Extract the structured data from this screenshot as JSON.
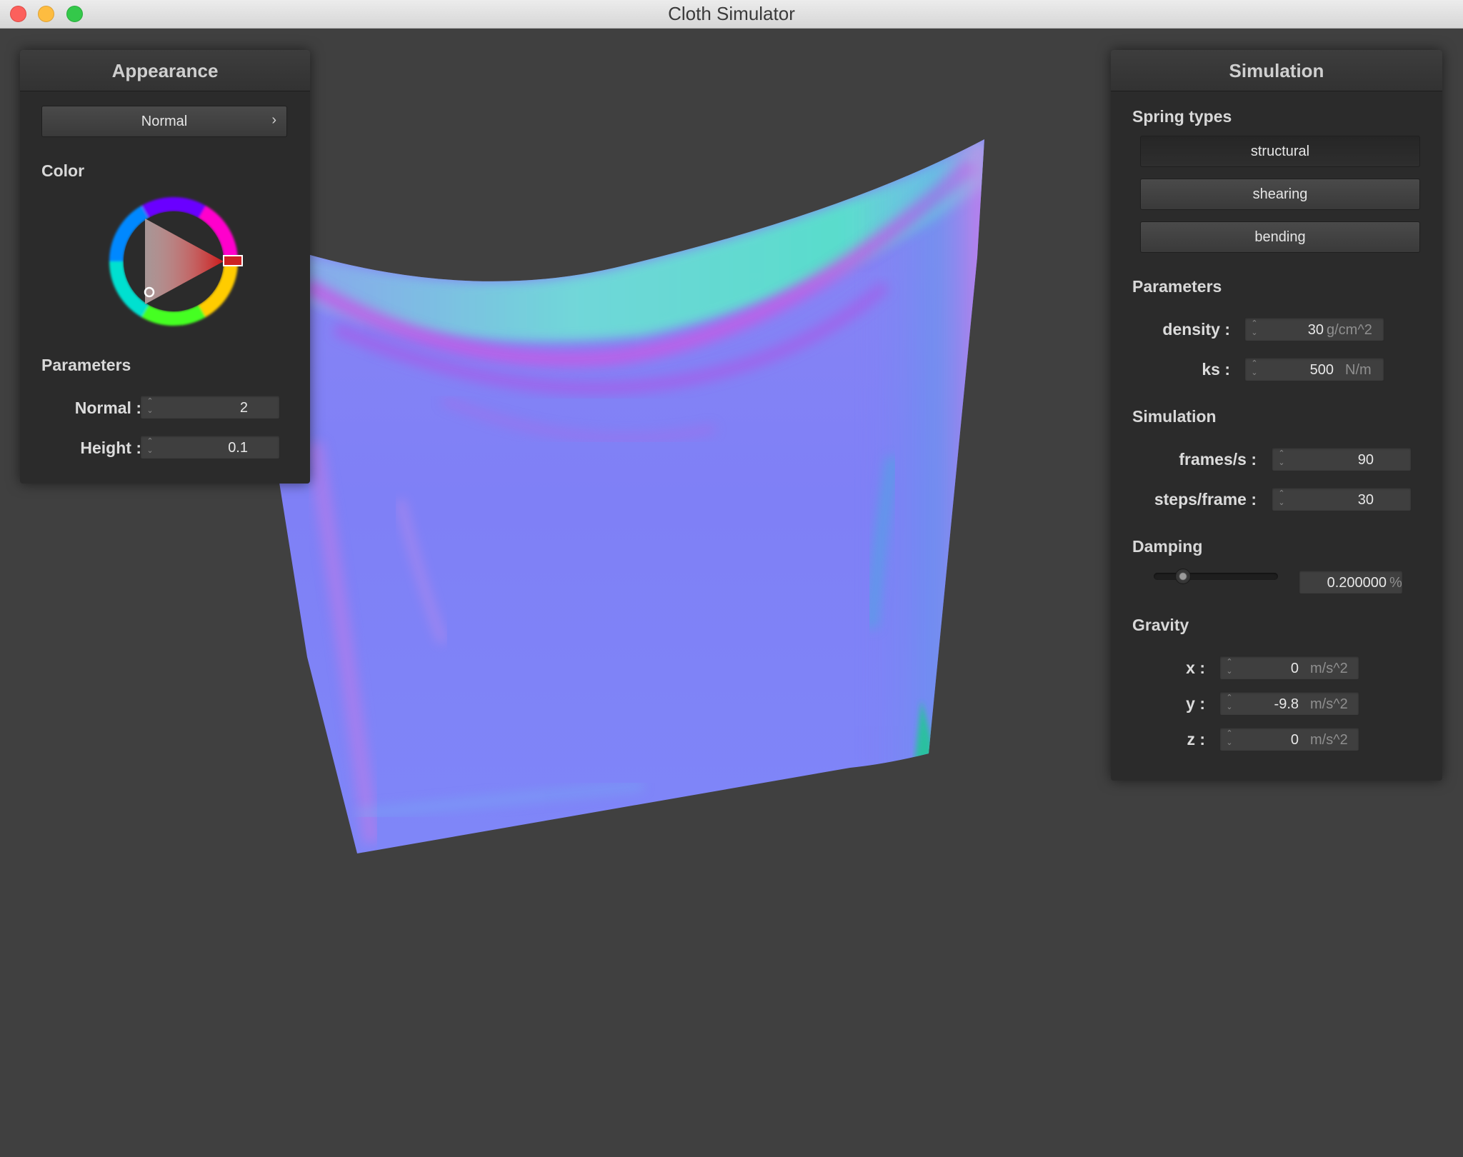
{
  "window": {
    "title": "Cloth Simulator"
  },
  "appearance": {
    "title": "Appearance",
    "shader": "Normal",
    "color_label": "Color",
    "color_value": "#cc2222",
    "params_label": "Parameters",
    "normal_label": "Normal :",
    "normal_value": "2",
    "height_label": "Height :",
    "height_value": "0.1"
  },
  "simulation": {
    "title": "Simulation",
    "spring_types_label": "Spring types",
    "springs": [
      "structural",
      "shearing",
      "bending"
    ],
    "params_label": "Parameters",
    "density_label": "density :",
    "density_value": "30",
    "density_unit": "g/cm^2",
    "ks_label": "ks :",
    "ks_value": "500",
    "ks_unit": "N/m",
    "sim_label": "Simulation",
    "fps_label": "frames/s :",
    "fps_value": "90",
    "spf_label": "steps/frame :",
    "spf_value": "30",
    "damping_label": "Damping",
    "damping_value": "0.200000",
    "damping_unit": "%",
    "damping_fraction": 0.2,
    "gravity_label": "Gravity",
    "gx_label": "x :",
    "gx_value": "0",
    "gy_label": "y :",
    "gy_value": "-9.8",
    "gz_label": "z :",
    "gz_value": "0",
    "gravity_unit": "m/s^2"
  }
}
